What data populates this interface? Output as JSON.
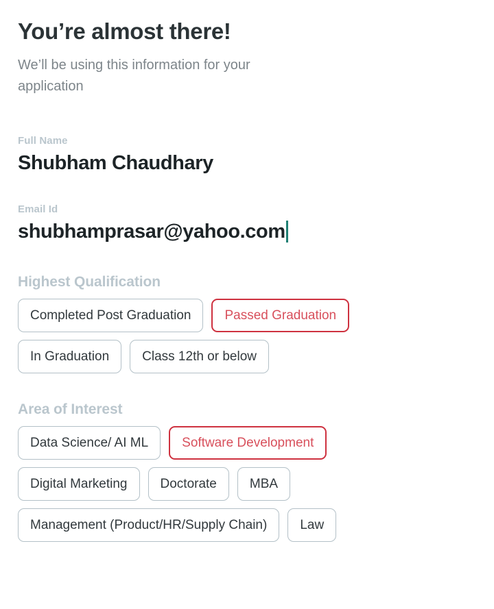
{
  "header": {
    "title": "You’re almost there!",
    "subtitle": "We’ll be using this information for your application"
  },
  "fields": [
    {
      "label": "Full Name",
      "value": "Shubham Chaudhary",
      "focused": false
    },
    {
      "label": "Email Id",
      "value": "shubhamprasar@yahoo.com",
      "focused": true
    }
  ],
  "sections": [
    {
      "title": "Highest Qualification",
      "rows": [
        [
          {
            "label": "Completed Post Graduation",
            "selected": false
          },
          {
            "label": "Passed Graduation",
            "selected": true
          }
        ],
        [
          {
            "label": "In Graduation",
            "selected": false
          },
          {
            "label": "Class 12th or below",
            "selected": false
          }
        ]
      ]
    },
    {
      "title": "Area of Interest",
      "rows": [
        [
          {
            "label": "Data Science/ AI ML",
            "selected": false
          },
          {
            "label": "Software Development",
            "selected": true
          }
        ],
        [
          {
            "label": "Digital Marketing",
            "selected": false
          },
          {
            "label": "Doctorate",
            "selected": false
          },
          {
            "label": "MBA",
            "selected": false
          }
        ],
        [
          {
            "label": "Management (Product/HR/Supply Chain)",
            "selected": false
          },
          {
            "label": "Law",
            "selected": false
          }
        ]
      ]
    }
  ],
  "colors": {
    "title": "#2b3336",
    "subtitle": "#7d858a",
    "label": "#bac6cd",
    "value": "#1d2427",
    "chip_border": "#b3c0c7",
    "chip_text": "#32393d",
    "selected_border": "#ce313f",
    "selected_text": "#d8505c",
    "caret": "#1e7f73",
    "background": "#ffffff"
  }
}
